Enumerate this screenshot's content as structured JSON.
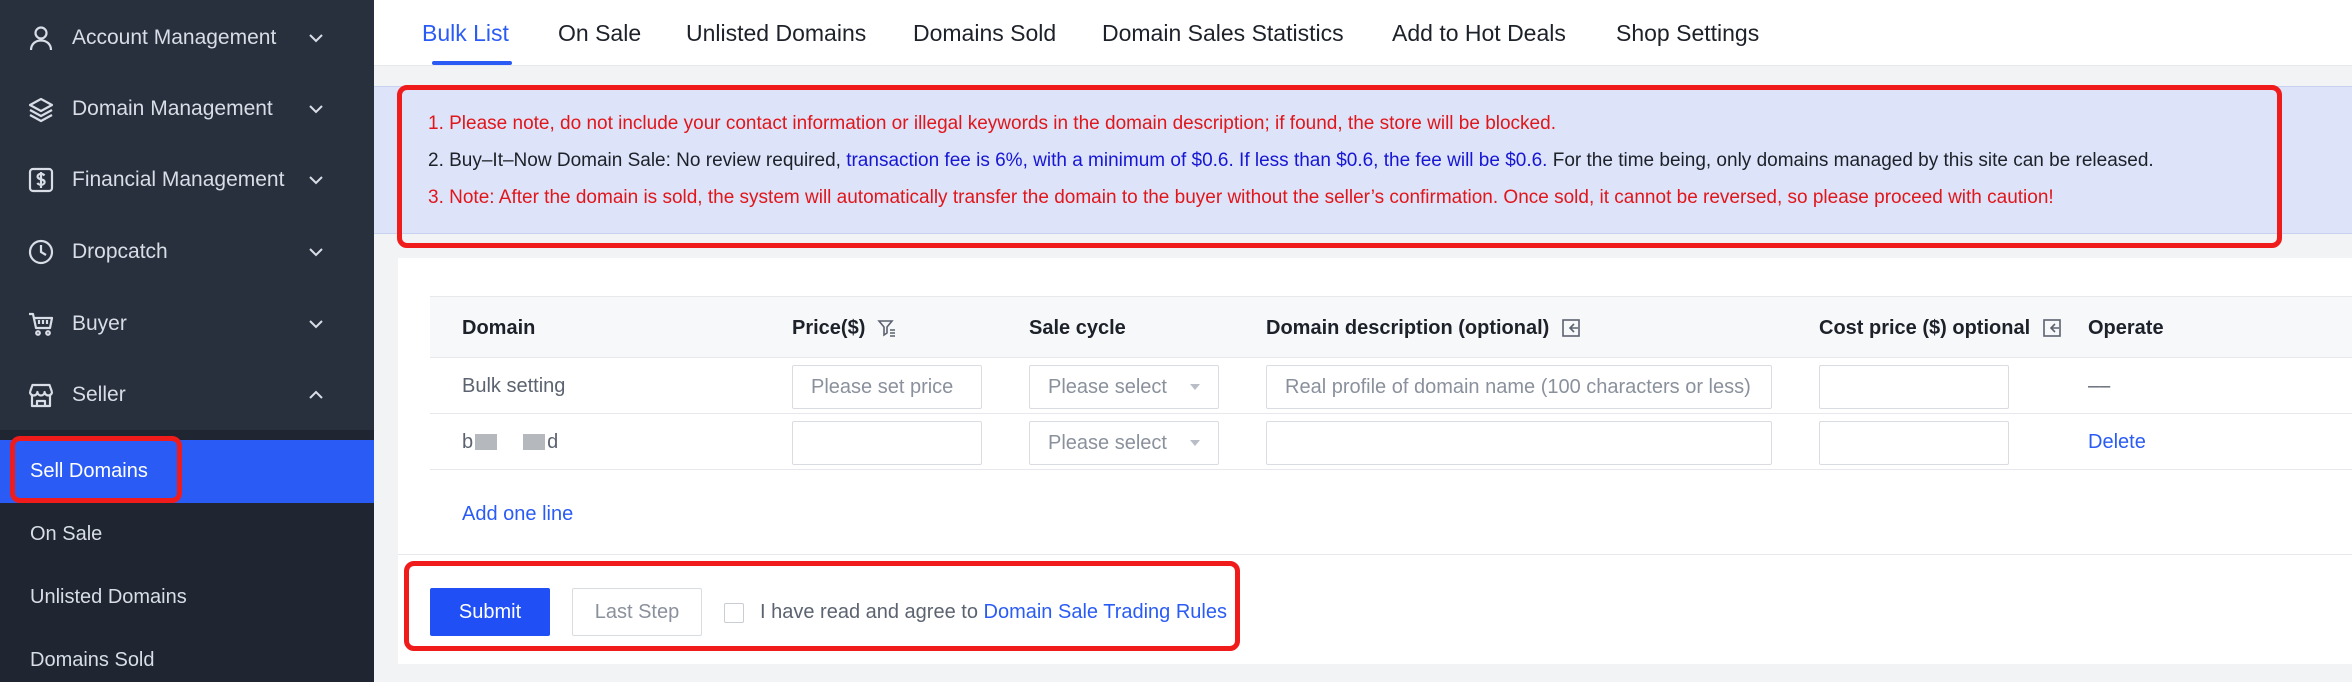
{
  "sidebar": {
    "items": [
      {
        "label": "Account Management",
        "icon": "user-icon",
        "expanded": false
      },
      {
        "label": "Domain Management",
        "icon": "layers-icon",
        "expanded": false
      },
      {
        "label": "Financial Management",
        "icon": "dollar-icon",
        "expanded": false
      },
      {
        "label": "Dropcatch",
        "icon": "clock-icon",
        "expanded": false
      },
      {
        "label": "Buyer",
        "icon": "cart-icon",
        "expanded": false
      },
      {
        "label": "Seller",
        "icon": "shop-icon",
        "expanded": true
      }
    ],
    "subitems": [
      {
        "label": "Sell Domains",
        "active": true
      },
      {
        "label": "On Sale",
        "active": false
      },
      {
        "label": "Unlisted Domains",
        "active": false
      },
      {
        "label": "Domains Sold",
        "active": false
      }
    ]
  },
  "tabs": [
    {
      "label": "Bulk List",
      "active": true
    },
    {
      "label": "On Sale",
      "active": false
    },
    {
      "label": "Unlisted Domains",
      "active": false
    },
    {
      "label": "Domains Sold",
      "active": false
    },
    {
      "label": "Domain Sales Statistics",
      "active": false
    },
    {
      "label": "Add to Hot Deals",
      "active": false
    },
    {
      "label": "Shop Settings",
      "active": false
    }
  ],
  "notice": {
    "line1": "1. Please note, do not include your contact information or illegal keywords in the domain description; if found, the store will be blocked.",
    "line2_a": "2. Buy–It–Now Domain Sale: No review required, ",
    "line2_b": "transaction fee is 6%, with a minimum of $0.6. If less than $0.6, the fee will be $0.6.",
    "line2_c": " For the time being, only domains managed by this site can be released.",
    "line3": "3. Note: After the domain is sold, the system will automatically transfer the domain to the buyer without the seller’s confirmation. Once sold, it cannot be reversed, so please proceed with caution!"
  },
  "table": {
    "headers": {
      "domain": "Domain",
      "price": "Price($)",
      "cycle": "Sale cycle",
      "desc": "Domain description (optional)",
      "cost": "Cost price ($) optional",
      "operate": "Operate"
    },
    "bulk": {
      "label": "Bulk setting",
      "price_placeholder": "Please set price",
      "cycle_placeholder": "Please select",
      "desc_placeholder": "Real profile of domain name (100 characters or less)",
      "operate": "––"
    },
    "row1": {
      "domain_start": "b",
      "domain_end": "d",
      "cycle_placeholder": "Please select",
      "operate": "Delete"
    },
    "add_line": "Add one line"
  },
  "footer": {
    "submit": "Submit",
    "last_step": "Last Step",
    "agree_text": "I have read and agree to ",
    "rules_link": "Domain Sale Trading Rules"
  },
  "colors": {
    "accent": "#2a5cf5",
    "sidebar_bg": "#28303e",
    "highlight": "#f01c1c",
    "notice_bg": "#dde3f8"
  }
}
